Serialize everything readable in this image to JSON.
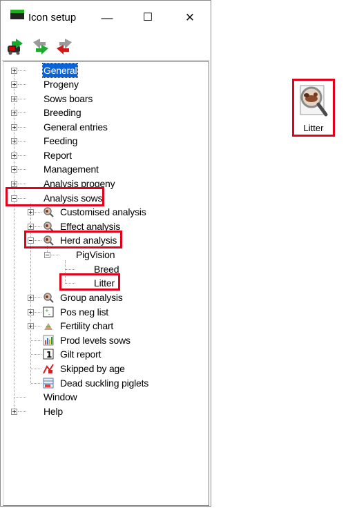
{
  "window": {
    "title": "Icon setup",
    "minimize": "—",
    "maximize": "☐",
    "close": "✕"
  },
  "toolbar": {
    "icons": [
      "export-car-icon",
      "forward-green-arrows-icon",
      "back-red-arrows-icon"
    ]
  },
  "tree": {
    "items": [
      {
        "label": "General",
        "selected": true
      },
      {
        "label": "Progeny"
      },
      {
        "label": "Sows boars"
      },
      {
        "label": "Breeding"
      },
      {
        "label": "General entries"
      },
      {
        "label": "Feeding"
      },
      {
        "label": "Report"
      },
      {
        "label": "Management"
      },
      {
        "label": "Analysis progeny"
      },
      {
        "label": "Analysis sows",
        "expanded": true
      },
      {
        "label": "Customised analysis"
      },
      {
        "label": "Effect analysis"
      },
      {
        "label": "Herd analysis",
        "expanded": true
      },
      {
        "label": "PigVision"
      },
      {
        "label": "Breed"
      },
      {
        "label": "Litter"
      },
      {
        "label": "Group analysis"
      },
      {
        "label": "Pos neg list"
      },
      {
        "label": "Fertility chart"
      },
      {
        "label": "Prod levels sows"
      },
      {
        "label": "Gilt report"
      },
      {
        "label": "Skipped by age"
      },
      {
        "label": "Dead suckling piglets"
      },
      {
        "label": "Window"
      },
      {
        "label": "Help"
      }
    ]
  },
  "preview": {
    "label": "Litter",
    "icon": "magnifier-pig-icon"
  },
  "colors": {
    "highlight": "#e3001b",
    "selection": "#0a64d6"
  }
}
